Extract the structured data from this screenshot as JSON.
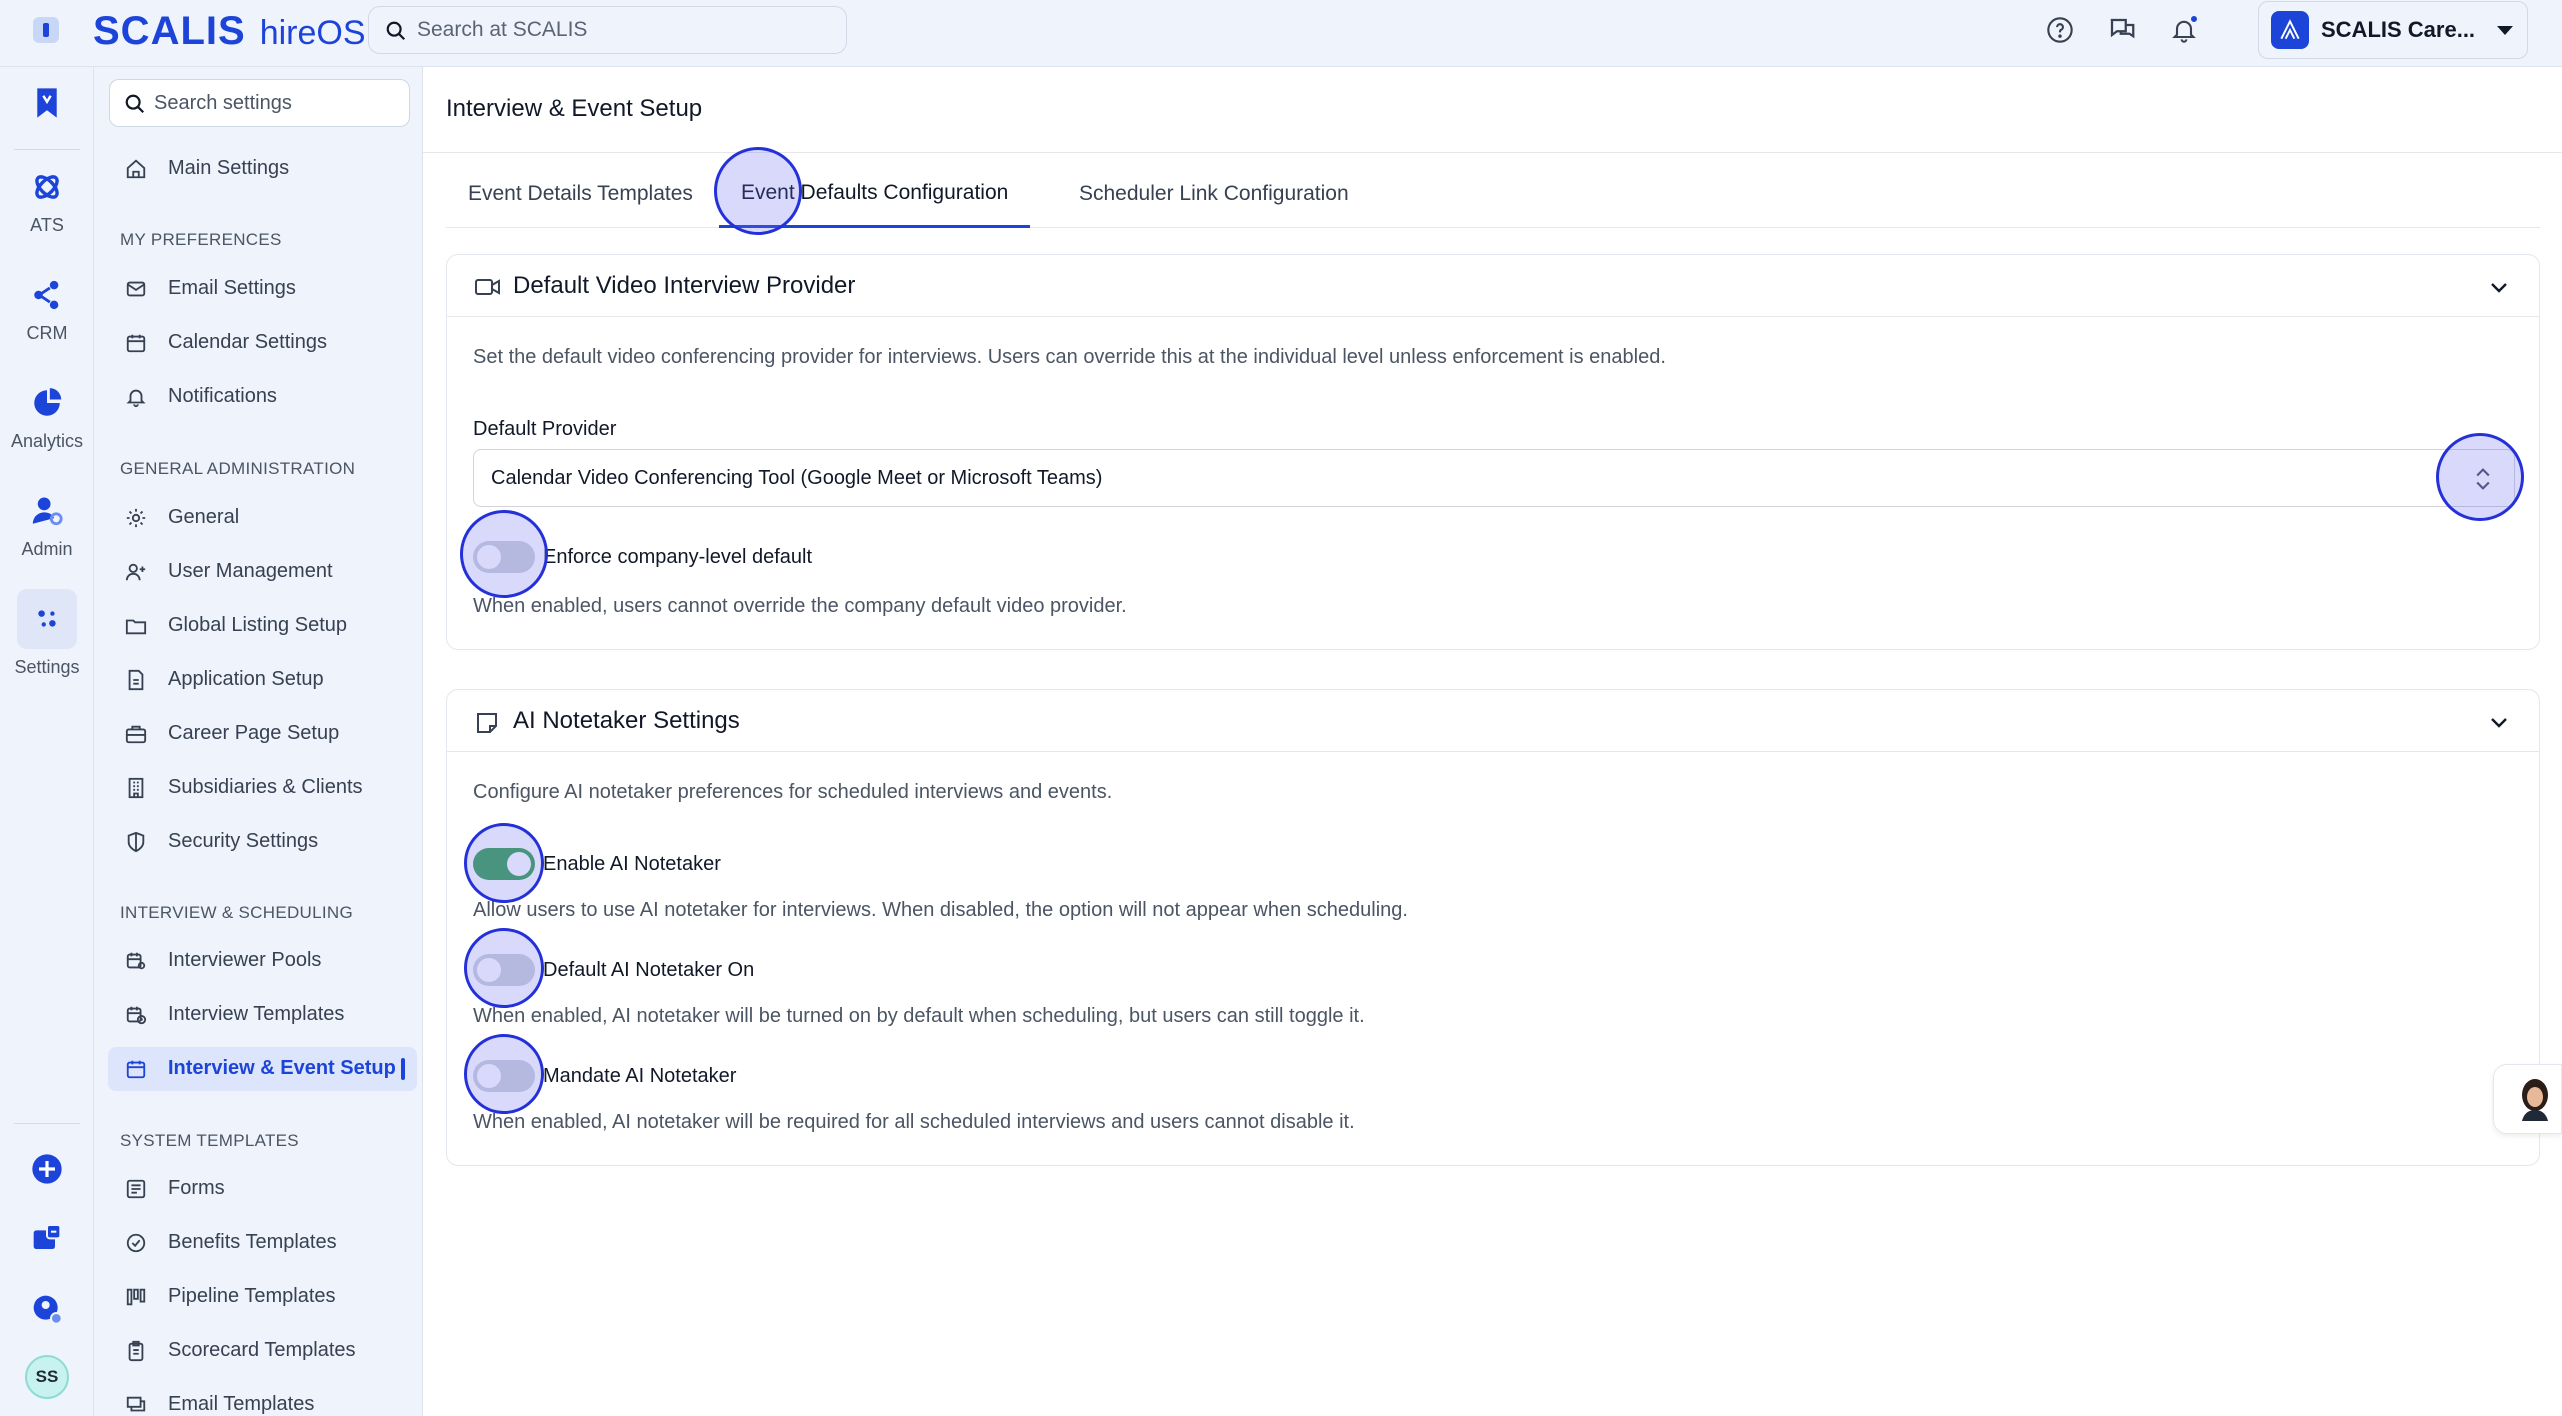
{
  "app": {
    "brand_primary": "SCALIS",
    "brand_secondary": "hireOS",
    "search_placeholder": "Search at SCALIS",
    "org_name": "SCALIS Care...",
    "colors": {
      "accent": "#1d44d8",
      "toggle_on": "#3fa35a",
      "toggle_off": "#d1d5db"
    }
  },
  "rail": {
    "items": [
      {
        "label": "",
        "icon": "bookmark-icon"
      },
      {
        "label": "ATS",
        "icon": "ats-icon"
      },
      {
        "label": "CRM",
        "icon": "crm-icon"
      },
      {
        "label": "Analytics",
        "icon": "analytics-icon"
      },
      {
        "label": "Admin",
        "icon": "admin-icon"
      },
      {
        "label": "Settings",
        "icon": "settings-icon"
      }
    ],
    "user_initials": "SS"
  },
  "settings_nav": {
    "search_placeholder": "Search settings",
    "main": "Main Settings",
    "sections": {
      "preferences": "MY PREFERENCES",
      "admin": "GENERAL ADMINISTRATION",
      "interview": "INTERVIEW & SCHEDULING",
      "system": "SYSTEM TEMPLATES"
    },
    "items": {
      "email_settings": "Email Settings",
      "calendar_settings": "Calendar Settings",
      "notifications": "Notifications",
      "general": "General",
      "user_management": "User Management",
      "global_listing": "Global Listing Setup",
      "application_setup": "Application Setup",
      "career_page": "Career Page Setup",
      "subsidiaries": "Subsidiaries & Clients",
      "security": "Security Settings",
      "interviewer_pools": "Interviewer Pools",
      "interview_templates": "Interview Templates",
      "interview_event_setup": "Interview & Event Setup",
      "forms": "Forms",
      "benefits_templates": "Benefits Templates",
      "pipeline_templates": "Pipeline Templates",
      "scorecard_templates": "Scorecard Templates",
      "email_templates": "Email Templates"
    }
  },
  "page": {
    "title": "Interview & Event Setup",
    "tabs": {
      "event_details": "Event Details Templates",
      "event_defaults": "Event Defaults Configuration",
      "scheduler_link": "Scheduler Link Configuration"
    },
    "active_tab": "Event Defaults Configuration"
  },
  "video_card": {
    "title": "Default Video Interview Provider",
    "description": "Set the default video conferencing provider for interviews. Users can override this at the individual level unless enforcement is enabled.",
    "provider_label": "Default Provider",
    "provider_value": "Calendar Video Conferencing Tool (Google Meet or Microsoft Teams)",
    "enforce_label": "Enforce company-level default",
    "enforce_on": false,
    "enforce_help": "When enabled, users cannot override the company default video provider."
  },
  "notetaker_card": {
    "title": "AI Notetaker Settings",
    "description": "Configure AI notetaker preferences for scheduled interviews and events.",
    "enable_label": "Enable AI Notetaker",
    "enable_on": true,
    "enable_help": "Allow users to use AI notetaker for interviews. When disabled, the option will not appear when scheduling.",
    "default_label": "Default AI Notetaker On",
    "default_on": false,
    "default_help": "When enabled, AI notetaker will be turned on by default when scheduling, but users can still toggle it.",
    "mandate_label": "Mandate AI Notetaker",
    "mandate_on": false,
    "mandate_help": "When enabled, AI notetaker will be required for all scheduled interviews and users cannot disable it."
  }
}
